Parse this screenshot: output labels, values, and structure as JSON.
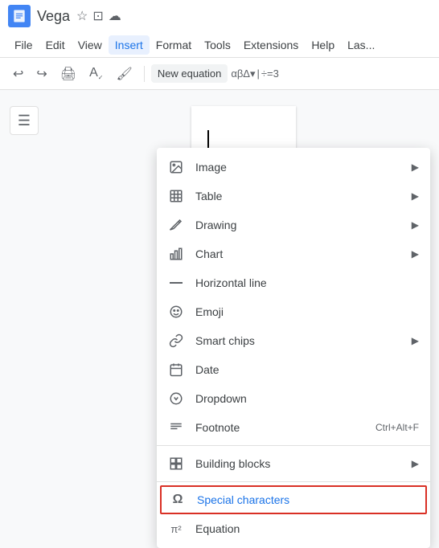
{
  "app": {
    "name": "Vega",
    "icon_alt": "docs-icon"
  },
  "titlebar": {
    "icons": [
      "star",
      "folder",
      "cloud"
    ]
  },
  "menubar": {
    "items": [
      {
        "label": "File",
        "active": false
      },
      {
        "label": "Edit",
        "active": false
      },
      {
        "label": "View",
        "active": false
      },
      {
        "label": "Insert",
        "active": true
      },
      {
        "label": "Format",
        "active": false
      },
      {
        "label": "Tools",
        "active": false
      },
      {
        "label": "Extensions",
        "active": false
      },
      {
        "label": "Help",
        "active": false
      },
      {
        "label": "Las...",
        "active": false
      }
    ]
  },
  "toolbar": {
    "new_equation_label": "New equation",
    "symbols": [
      "αβΔ▾",
      "÷=3"
    ]
  },
  "dropdown": {
    "items": [
      {
        "id": "image",
        "icon": "🖼",
        "label": "Image",
        "has_arrow": true
      },
      {
        "id": "table",
        "icon": "⊞",
        "label": "Table",
        "has_arrow": true
      },
      {
        "id": "drawing",
        "icon": "✏",
        "label": "Drawing",
        "has_arrow": true
      },
      {
        "id": "chart",
        "icon": "📊",
        "label": "Chart",
        "has_arrow": true
      },
      {
        "id": "horizontal-line",
        "icon": "—",
        "label": "Horizontal line",
        "has_arrow": false
      },
      {
        "id": "emoji",
        "icon": "😊",
        "label": "Emoji",
        "has_arrow": false
      },
      {
        "id": "smart-chips",
        "icon": "🔗",
        "label": "Smart chips",
        "has_arrow": true
      },
      {
        "id": "date",
        "icon": "📅",
        "label": "Date",
        "has_arrow": false
      },
      {
        "id": "dropdown",
        "icon": "⊙",
        "label": "Dropdown",
        "has_arrow": false
      },
      {
        "id": "footnote",
        "icon": "≡",
        "label": "Footnote",
        "shortcut": "Ctrl+Alt+F",
        "has_arrow": false
      },
      {
        "id": "building-blocks",
        "icon": "⊞",
        "label": "Building blocks",
        "has_arrow": true
      },
      {
        "id": "special-characters",
        "icon": "Ω",
        "label": "Special characters",
        "has_arrow": false,
        "highlighted": true
      },
      {
        "id": "equation",
        "icon": "π²",
        "label": "Equation",
        "has_arrow": false
      }
    ]
  }
}
